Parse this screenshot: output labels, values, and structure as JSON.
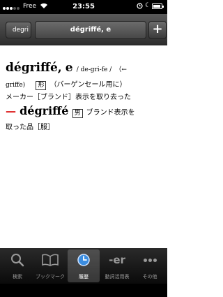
{
  "status_bar": {
    "carrier": "Free",
    "time": "23:55"
  },
  "nav": {
    "back_label": "degri",
    "title": "dégriffé, e",
    "add_label": "+"
  },
  "entry": {
    "headword": "dégriffé,",
    "headword_suffix": "e",
    "pronunciation": "/ de-gri-fe /",
    "etymology_open": "（←",
    "etymology_word": "griffe)",
    "pos_adj": "形",
    "context": "（バーゲンセール用に）",
    "definition1": "メーカー［ブランド］表示を取り去った",
    "sub_dash": "—",
    "sub_headword": "dégriffé",
    "pos_noun": "男",
    "definition2a": "ブランド表示を",
    "definition2b": "取った品［服］"
  },
  "tabs": [
    {
      "label": "検索",
      "icon": "magnifier-icon"
    },
    {
      "label": "ブックマーク",
      "icon": "book-icon"
    },
    {
      "label": "履歴",
      "icon": "clock-icon",
      "active": true
    },
    {
      "label": "動詞活用表",
      "icon": "er-icon",
      "text": "-er"
    },
    {
      "label": "その他",
      "icon": "more-icon"
    }
  ]
}
